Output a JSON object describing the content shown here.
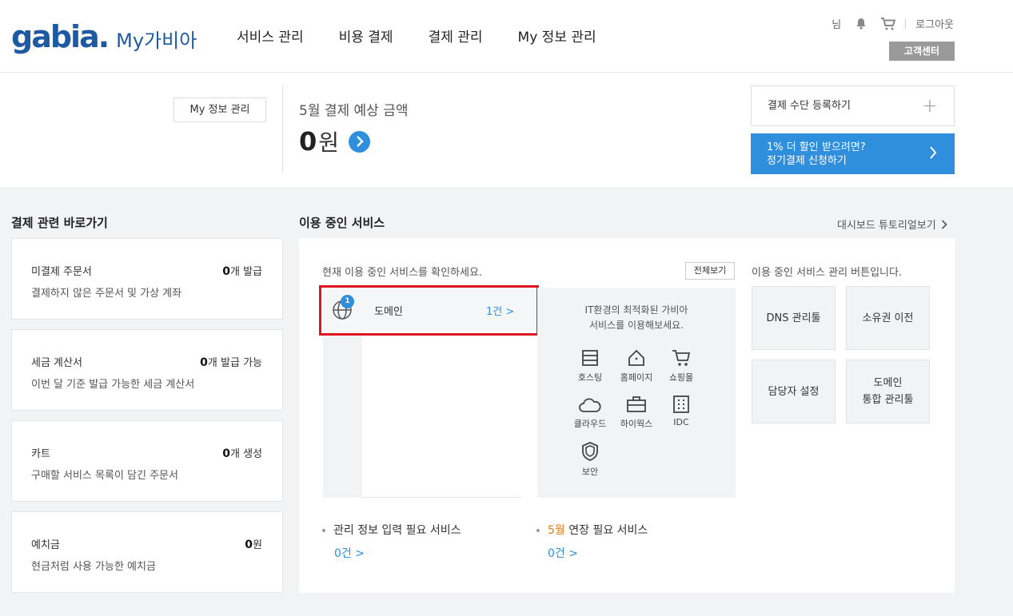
{
  "header": {
    "brand": "gabia.",
    "subtitle": "My가비아",
    "nav": [
      "서비스 관리",
      "비용 결제",
      "결제 관리",
      "My 정보 관리"
    ],
    "user_suffix": "님",
    "logout": "로그아웃",
    "customer_center": "고객센터"
  },
  "summary": {
    "myinfo_button": "My 정보 관리",
    "estimate_label": "5월 결제 예상 금액",
    "estimate_amount": "0",
    "estimate_unit": "원",
    "payment_register": "결제 수단 등록하기",
    "promo_line1": "1% 더 할인 받으려면?",
    "promo_line2": "정기결제 신청하기"
  },
  "shortcuts": {
    "title": "결제 관련 바로가기",
    "cards": [
      {
        "title": "미결제 주문서",
        "count": "0",
        "suffix": "개 발급",
        "desc": "결제하지 않은 주문서 및 가상 계좌"
      },
      {
        "title": "세금 계산서",
        "count": "0",
        "suffix": "개 발급 가능",
        "desc": "이번 달 기준 발급 가능한 세금 계산서"
      },
      {
        "title": "카트",
        "count": "0",
        "suffix": "개 생성",
        "desc": "구매할 서비스 목록이 담긴 주문서"
      },
      {
        "title": "예치금",
        "count": "0",
        "suffix": "원",
        "desc": "현금처럼 사용 가능한 예치금"
      }
    ]
  },
  "services": {
    "title": "이용 중인 서비스",
    "tutorial": "대시보드 튜토리얼보기",
    "desc": "현재 이용 중인 서비스를 확인하세요.",
    "view_all": "전체보기",
    "items": [
      {
        "name": "도메인",
        "count": "1건 >",
        "badge": "1"
      }
    ],
    "promo_line1": "IT환경의 최적화된 가비아",
    "promo_line2": "서비스를 이용해보세요.",
    "tiles": [
      {
        "label": "호스팅",
        "icon": "hosting-icon"
      },
      {
        "label": "홈페이지",
        "icon": "homepage-icon"
      },
      {
        "label": "쇼핑몰",
        "icon": "shopping-cart-icon"
      },
      {
        "label": "클라우드",
        "icon": "cloud-icon"
      },
      {
        "label": "하이웍스",
        "icon": "briefcase-icon"
      },
      {
        "label": "IDC",
        "icon": "idc-building-icon"
      },
      {
        "label": "보안",
        "icon": "shield-icon"
      }
    ],
    "mgmt_desc": "이용 중인 서비스 관리 버튼입니다.",
    "mgmt_buttons": [
      "DNS 관리툴",
      "소유권 이전",
      "담당자 설정",
      "도메인\n통합 관리툴"
    ],
    "info_required": {
      "label": "관리 정보 입력 필요 서비스",
      "count": "0건 >"
    },
    "renewal": {
      "month": "5월",
      "label": " 연장 필요 서비스",
      "count": "0건 >"
    }
  },
  "colors": {
    "accent": "#2f8fdc",
    "brand": "#1e5aa3",
    "highlight": "#e0141e",
    "month": "#e07b14"
  }
}
